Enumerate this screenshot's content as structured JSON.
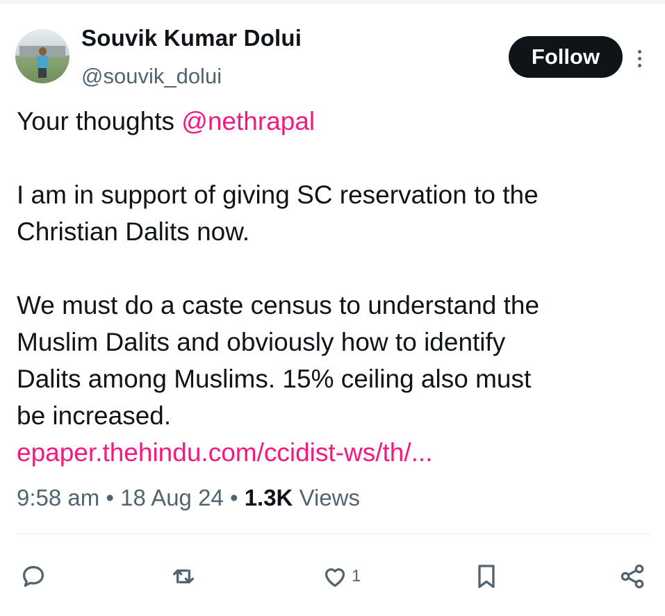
{
  "author": {
    "name": "Souvik Kumar Dolui",
    "handle": "@souvik_dolui"
  },
  "follow_label": "Follow",
  "tweet": {
    "line1_prefix": "Your thoughts ",
    "mention": "@nethrapal",
    "para2_line1": "I am in support of giving SC reservation to the",
    "para2_line2": "Christian Dalits now.",
    "para3_line1": "We must do a caste census to understand the",
    "para3_line2": "Muslim Dalits and obviously how to identify",
    "para3_line3": "Dalits among Muslims. 15% ceiling also must",
    "para3_line4": "be increased.",
    "link": "epaper.thehindu.com/ccidist-ws/th/..."
  },
  "meta": {
    "time": "9:58 am",
    "sep1": " • ",
    "date": "18 Aug 24",
    "sep2": " • ",
    "views_count": "1.3K",
    "views_label": " Views"
  },
  "actions": {
    "like_count": "1"
  },
  "colors": {
    "accent_pink": "#f91880",
    "text": "#0f1419",
    "muted": "#536471"
  },
  "icons": [
    "reply-icon",
    "retweet-icon",
    "like-icon",
    "bookmark-icon",
    "share-icon",
    "more-options-icon"
  ]
}
